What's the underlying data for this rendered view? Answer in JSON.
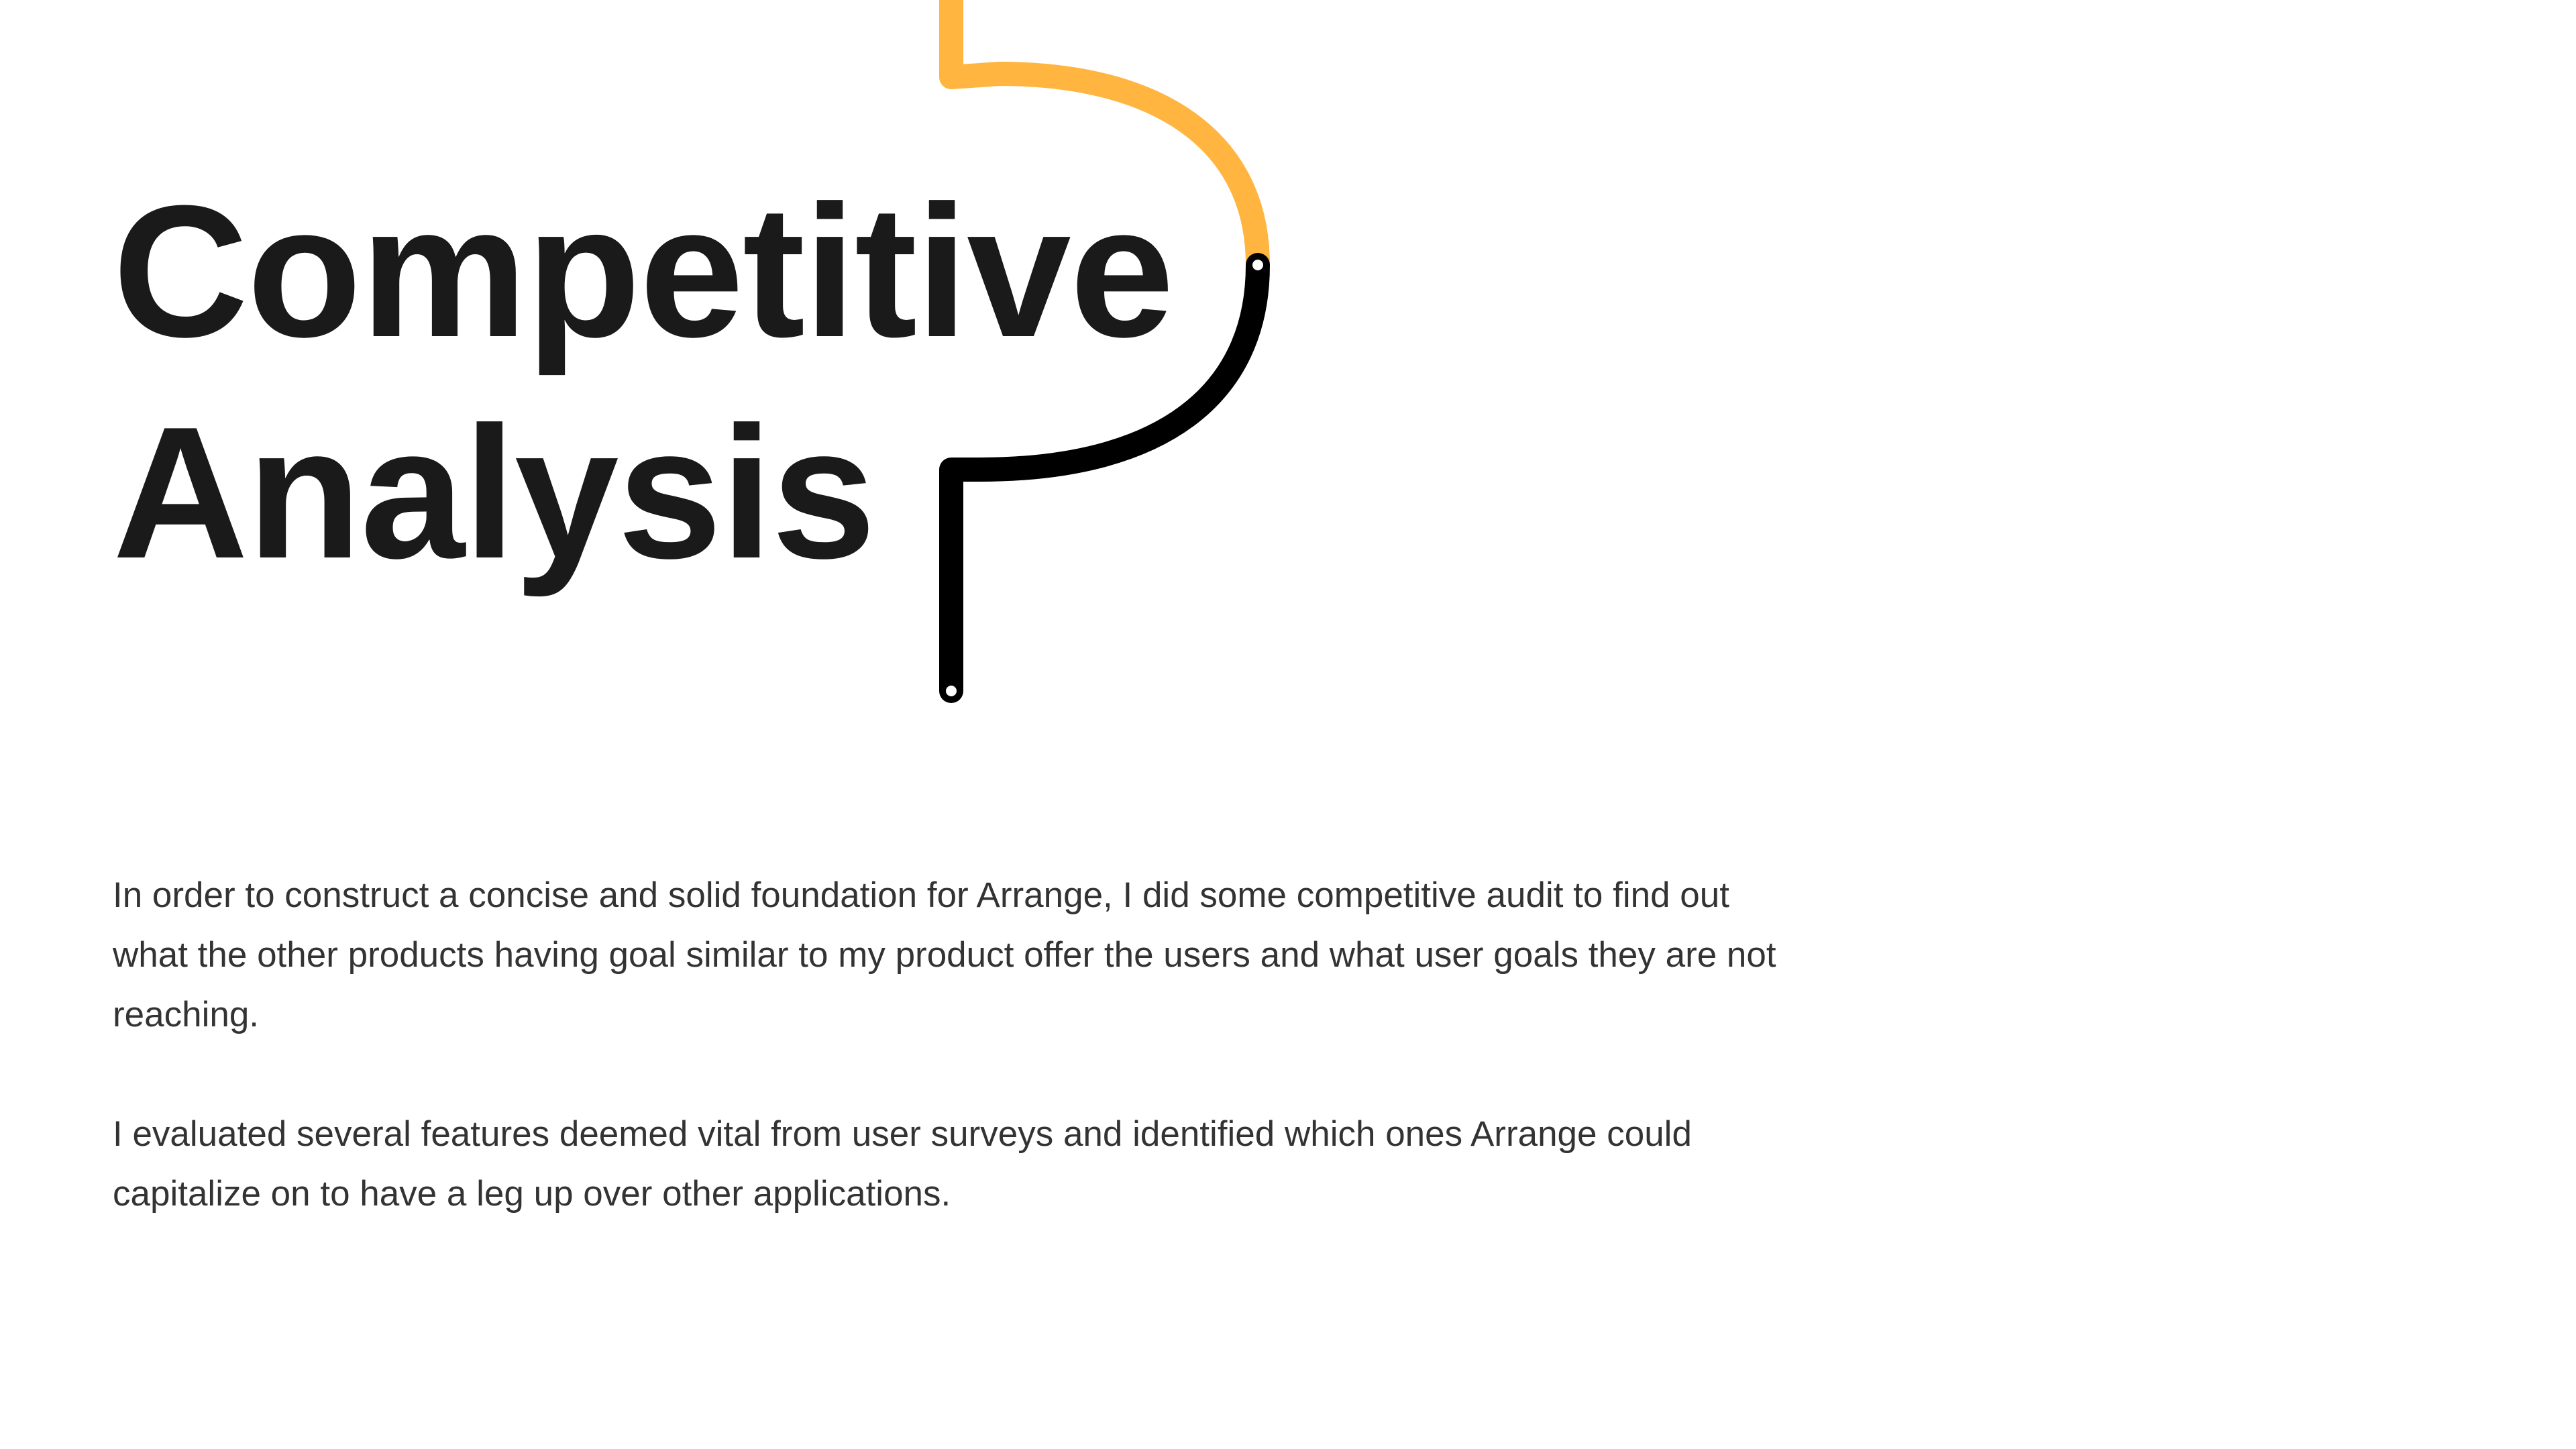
{
  "heading": {
    "line1": "Competitive",
    "line2": "Analysis"
  },
  "paragraphs": [
    "In order to construct a concise and solid foundation for Arrange, I did some competitive audit to find out what the other products having goal similar to my product offer the users and what user goals they are not reaching.",
    "I evaluated several features deemed vital from user surveys and identified which ones Arrange could capitalize on to have a leg up over other applications."
  ],
  "colors": {
    "accent": "#FFB53F",
    "line_dark": "#000000",
    "heading": "#1A1A1A",
    "body_text": "#333333",
    "background": "#FFFFFF"
  }
}
